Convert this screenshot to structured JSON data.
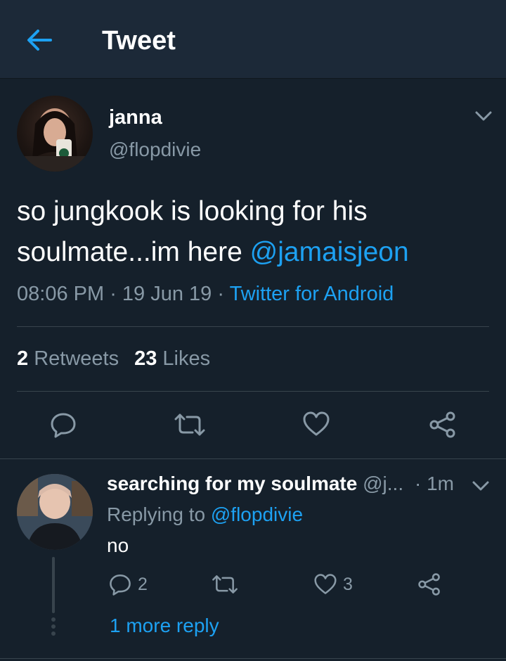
{
  "header": {
    "title": "Tweet",
    "back_icon": "arrow-left-icon"
  },
  "colors": {
    "background": "#15202b",
    "header_background": "#1c2938",
    "accent": "#1da1f2",
    "secondary_text": "#8899a6",
    "divider": "#38444d"
  },
  "tweet": {
    "display_name": "janna",
    "handle": "@flopdivie",
    "text_line1": "so jungkook is looking for his",
    "text_line2": "soulmate...im here ",
    "mention": "@jamaisjeon",
    "time": "08:06 PM",
    "separator": " · ",
    "date": "19 Jun 19",
    "source": "Twitter for Android",
    "retweets_count": "2",
    "retweets_label": "Retweets",
    "likes_count": "23",
    "likes_label": "Likes"
  },
  "reply": {
    "display_name": "searching for my soulmate",
    "handle": "@j...",
    "time": "· 1m",
    "replying_prefix": "Replying to ",
    "replying_to": "@flopdivie",
    "text": "no",
    "reply_count": "2",
    "like_count": "3",
    "more_replies": "1 more reply"
  }
}
